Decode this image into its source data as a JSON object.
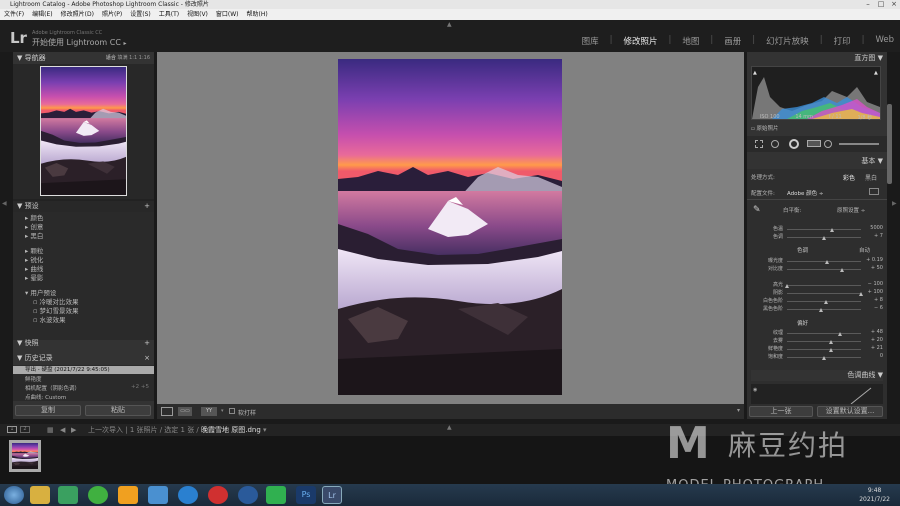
{
  "window": {
    "title": "Lightroom Catalog - Adobe Photoshop Lightroom Classic - 修改照片"
  },
  "menu": [
    "文件(F)",
    "编辑(E)",
    "修改照片(D)",
    "照片(P)",
    "设置(S)",
    "工具(T)",
    "视图(V)",
    "窗口(W)",
    "帮助(H)"
  ],
  "identity": {
    "logo": "Lr",
    "line1": "Adobe Lightroom Classic CC",
    "line2": "开始使用 Lightroom CC"
  },
  "modules": [
    "图库",
    "修改照片",
    "地图",
    "画册",
    "幻灯片放映",
    "打印",
    "Web"
  ],
  "modules_active": "修改照片",
  "navigator": {
    "title": "导航器",
    "zoom": [
      "适合",
      "填满",
      "1:1",
      "1:16"
    ]
  },
  "presets": {
    "title": "预设",
    "items": [
      "颜色",
      "创意",
      "黑白",
      "颗粒",
      "锐化",
      "曲线",
      "晕影"
    ],
    "user_presets": "用户预设",
    "user_items": [
      "冷暖对比效果",
      "梦幻雪景效果",
      "水波效果"
    ]
  },
  "snapshots": {
    "title": "快照"
  },
  "history": {
    "title": "历史记录",
    "items": [
      {
        "label": "导出 - 硬盘 (2021/7/22 9:45:05)",
        "value": ""
      },
      {
        "label": "鲜艳度",
        "value": ""
      },
      {
        "label": "相机配置（阴影色调）",
        "value": "+2  +5"
      },
      {
        "label": "点曲线: Custom",
        "value": ""
      }
    ]
  },
  "left_buttons": {
    "copy": "复制",
    "paste": "粘贴"
  },
  "histogram": {
    "title": "直方图",
    "iso": "ISO 100",
    "focal": "14 mm",
    "aperture": "f / 11",
    "shutter": "1/8 秒",
    "original": "原始照片"
  },
  "basic": {
    "title": "基本",
    "treatment_label": "处理方式:",
    "color": "彩色",
    "bw": "黑白",
    "profile_label": "配置文件:",
    "profile_value": "Adobe 颜色",
    "wb_label": "白平衡:",
    "wb_value": "原照设置 ÷",
    "temp": {
      "label": "色温",
      "value": "5000"
    },
    "tint": {
      "label": "色调",
      "value": "+ 7"
    },
    "tone_label": "色调",
    "auto": "自动",
    "exposure": {
      "label": "曝光度",
      "value": "+ 0.19"
    },
    "contrast": {
      "label": "对比度",
      "value": "+ 50"
    },
    "highlights": {
      "label": "高光",
      "value": "− 100"
    },
    "shadows": {
      "label": "阴影",
      "value": "+ 100"
    },
    "whites": {
      "label": "白色色阶",
      "value": "+ 8"
    },
    "blacks": {
      "label": "黑色色阶",
      "value": "− 6"
    },
    "presence_label": "偏好",
    "texture": {
      "label": "纹理",
      "value": "+ 48"
    },
    "clarity": {
      "label": "去雾",
      "value": "+ 20"
    },
    "vibrance": {
      "label": "鲜艳度",
      "value": "+ 21"
    },
    "saturation": {
      "label": "饱和度",
      "value": "0"
    }
  },
  "tone_curve": {
    "title": "色调曲线"
  },
  "right_buttons": {
    "previous": "上一张",
    "reset": "设置默认设置..."
  },
  "toolbar": {
    "softproof": "软打样"
  },
  "filmstrip": {
    "pages": [
      "1",
      "2"
    ],
    "source": "上一次导入",
    "info": "1 张照片 / 选定 1 张 / ",
    "filename": "晚霞雪地 原图.dng"
  },
  "taskbar": {
    "time": "9:48",
    "date": "2021/7/22"
  },
  "watermark": {
    "brand": "麻豆约拍",
    "sub": "MODEL PHOTOGRAPH"
  }
}
